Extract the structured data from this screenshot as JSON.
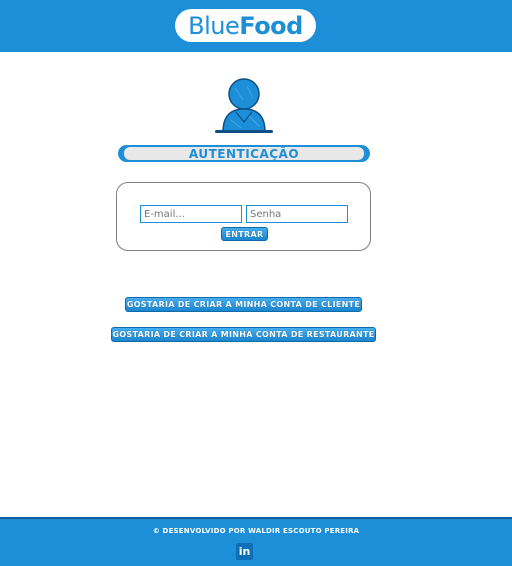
{
  "header": {
    "logo_part1": "Blue",
    "logo_part2": "Food"
  },
  "auth": {
    "title": "AUTENTICAÇÃO",
    "email_placeholder": "E-mail...",
    "password_placeholder": "Senha",
    "submit_label": "ENTRAR"
  },
  "actions": {
    "create_client_label": "GOSTARIA DE CRIAR A MINHA CONTA DE CLIENTE",
    "create_restaurant_label": "GOSTARIA DE CRIAR A MINHA CONTA DE RESTAURANTE"
  },
  "footer": {
    "copyright": "© DESENVOLVIDO POR WALDIR ESCOUTO PEREIRA",
    "social_icon": "linkedin-icon",
    "social_text": "in"
  },
  "colors": {
    "brand_blue": "#1d8fd8",
    "dark_blue": "#0b5fa0"
  }
}
